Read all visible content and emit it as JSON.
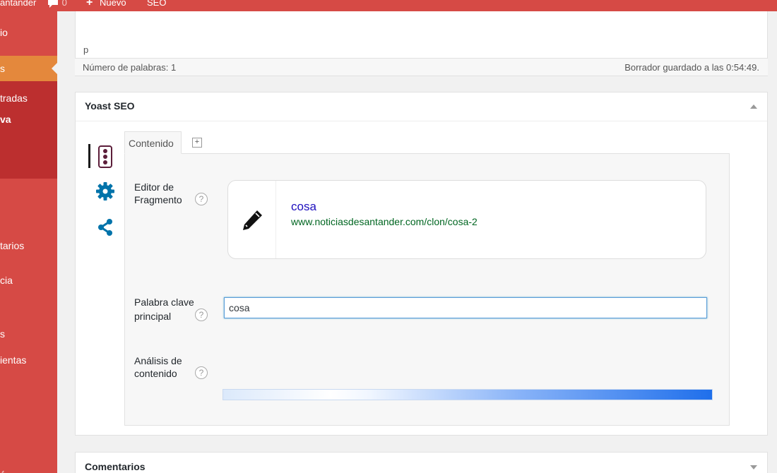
{
  "adminbar": {
    "site_name": "antander",
    "comments_count": "0",
    "new_label": "Nuevo",
    "seo_label": "SEO"
  },
  "sidebar": {
    "items": [
      {
        "label": "io"
      },
      {
        "label": "s"
      },
      {
        "label": "tradas"
      },
      {
        "label": "va"
      },
      {
        "label": "tarios"
      },
      {
        "label": "cia"
      },
      {
        "label": "s"
      },
      {
        "label": "ientas"
      },
      {
        "label": "ó"
      }
    ]
  },
  "editor": {
    "path": "p",
    "word_count": "Número de palabras: 1",
    "draft_saved": "Borrador guardado a las 0:54:49."
  },
  "yoast": {
    "title": "Yoast SEO",
    "tabs": [
      {
        "label": "Contenido"
      },
      {
        "label": "+"
      }
    ],
    "snippet_editor_label_1": "Editor de",
    "snippet_editor_label_2": "Fragmento",
    "snippet": {
      "title": "cosa",
      "url": "www.noticiasdesantander.com/clon/cosa-2"
    },
    "keyword_label_1": "Palabra clave",
    "keyword_label_2": "principal",
    "keyword_value": "cosa",
    "analysis_label_1": "Análisis de",
    "analysis_label_2": "contenido",
    "help_glyph": "?"
  },
  "comments": {
    "title": "Comentarios"
  },
  "colors": {
    "adminbar": "#d64a45",
    "sidebar": "#d64a45",
    "sidebar_active": "#e4883c",
    "sidebar_submenu": "#bc2f2f",
    "yoast_icons": "#0073aa",
    "traffic_light": "#5c1e3a",
    "snippet_title": "#1e0fbe",
    "snippet_url": "#006621"
  }
}
